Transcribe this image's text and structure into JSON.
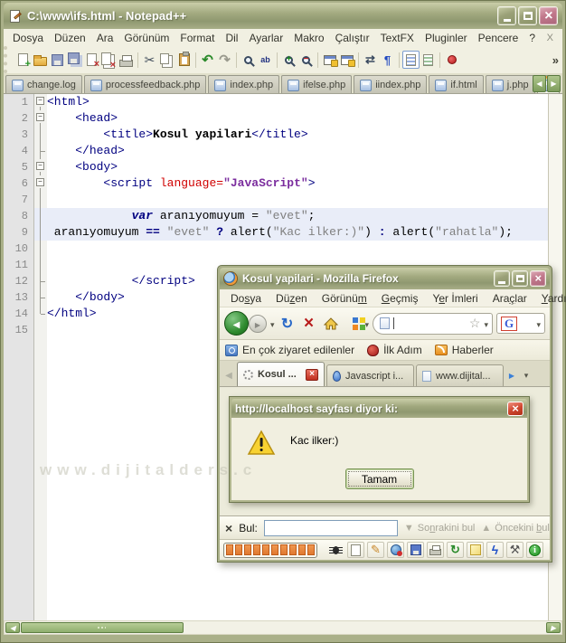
{
  "watermark": "www.dijitalders.c",
  "colors": {
    "titlebar_olive": "#9ba37a",
    "close_pink": "#c2798c",
    "chrome_bg": "#f1f0e2",
    "tab_active_orange": "#f0a13c",
    "selection_blue": "#e9edf8",
    "progress_orange": "#e07830"
  },
  "npp": {
    "title": "C:\\www\\ifs.html - Notepad++",
    "menu": [
      "Dosya",
      "Düzen",
      "Ara",
      "Görünüm",
      "Format",
      "Dil",
      "Ayarlar",
      "Makro",
      "Çalıştır",
      "TextFX",
      "Pluginler",
      "Pencere",
      "?"
    ],
    "menu_close": "X",
    "toolbar_overflow": "»",
    "toolbar": [
      {
        "name": "new"
      },
      {
        "name": "open"
      },
      {
        "name": "save"
      },
      {
        "name": "save-copy"
      },
      {
        "name": "close"
      },
      {
        "name": "close-all"
      },
      {
        "name": "print"
      },
      {
        "sep": true
      },
      {
        "name": "cut"
      },
      {
        "name": "copy"
      },
      {
        "name": "paste"
      },
      {
        "sep": true
      },
      {
        "name": "undo"
      },
      {
        "name": "redo"
      },
      {
        "sep": true
      },
      {
        "name": "find"
      },
      {
        "name": "find2"
      },
      {
        "sep": true
      },
      {
        "name": "zoom-in"
      },
      {
        "name": "zoom-out"
      },
      {
        "sep": true
      },
      {
        "name": "sync-v"
      },
      {
        "name": "sync-h"
      },
      {
        "sep": true
      },
      {
        "name": "wrap"
      },
      {
        "name": "symbols"
      },
      {
        "sep": true
      },
      {
        "name": "doc-map",
        "active": true
      },
      {
        "name": "func-list"
      },
      {
        "sep": true
      },
      {
        "name": "record"
      }
    ],
    "tabs": [
      {
        "label": "change.log"
      },
      {
        "label": "processfeedback.php"
      },
      {
        "label": "index.php"
      },
      {
        "label": "ifelse.php"
      },
      {
        "label": "iindex.php"
      },
      {
        "label": "if.html"
      },
      {
        "label": "j.php"
      },
      {
        "label": "",
        "active": true
      }
    ],
    "code_lines": [
      {
        "n": 1,
        "fold": "start",
        "segs": [
          [
            "tag",
            "<html>"
          ]
        ]
      },
      {
        "n": 2,
        "fold": "start",
        "segs": [
          [
            "pl",
            "    "
          ],
          [
            "tag",
            "<head>"
          ]
        ]
      },
      {
        "n": 3,
        "fold": "mid",
        "segs": [
          [
            "pl",
            "        "
          ],
          [
            "tag",
            "<title>"
          ],
          [
            "bold",
            "Kosul yapilari"
          ],
          [
            "tag",
            "</title>"
          ]
        ]
      },
      {
        "n": 4,
        "fold": "end",
        "segs": [
          [
            "pl",
            "    "
          ],
          [
            "tag",
            "</head>"
          ]
        ]
      },
      {
        "n": 5,
        "fold": "start",
        "segs": [
          [
            "pl",
            "    "
          ],
          [
            "tag",
            "<body>"
          ]
        ]
      },
      {
        "n": 6,
        "fold": "start",
        "segs": [
          [
            "pl",
            "        "
          ],
          [
            "tag",
            "<script "
          ],
          [
            "attr",
            "language="
          ],
          [
            "attrval",
            "\"JavaScript\""
          ],
          [
            "tag",
            ">"
          ]
        ]
      },
      {
        "n": 7,
        "fold": "mid",
        "segs": []
      },
      {
        "n": 8,
        "fold": "mid",
        "sel": true,
        "segs": [
          [
            "pl",
            "            "
          ],
          [
            "kw",
            "var"
          ],
          [
            "pl",
            " aranıyomuyum = "
          ],
          [
            "str",
            "\"evet\""
          ],
          [
            "pl",
            ";"
          ]
        ]
      },
      {
        "n": 9,
        "fold": "mid",
        "sel": true,
        "segs": [
          [
            "pl",
            " aranıyomuyum "
          ],
          [
            "op",
            "=="
          ],
          [
            "pl",
            " "
          ],
          [
            "str",
            "\"evet\""
          ],
          [
            "pl",
            " "
          ],
          [
            "op",
            "?"
          ],
          [
            "pl",
            " alert("
          ],
          [
            "str",
            "\"Kac ilker:)\""
          ],
          [
            "pl",
            ") "
          ],
          [
            "op",
            ":"
          ],
          [
            "pl",
            " alert("
          ],
          [
            "str",
            "\"rahatla\""
          ],
          [
            "pl",
            ");"
          ]
        ]
      },
      {
        "n": 10,
        "fold": "mid",
        "segs": []
      },
      {
        "n": 11,
        "fold": "mid",
        "segs": []
      },
      {
        "n": 12,
        "fold": "end",
        "segs": [
          [
            "pl",
            "            "
          ],
          [
            "tag",
            "</script>"
          ]
        ]
      },
      {
        "n": 13,
        "fold": "end",
        "segs": [
          [
            "pl",
            "    "
          ],
          [
            "tag",
            "</body>"
          ]
        ]
      },
      {
        "n": 14,
        "fold": "last",
        "segs": [
          [
            "tag",
            "</html>"
          ]
        ]
      },
      {
        "n": 15,
        "fold": "none",
        "segs": []
      }
    ]
  },
  "firefox": {
    "title": "Kosul yapilari - Mozilla Firefox",
    "menu": [
      {
        "label": "Dosya",
        "ul": 2
      },
      {
        "label": "Düzen",
        "ul": 2
      },
      {
        "label": "Görünüm",
        "ul": 6
      },
      {
        "label": "Geçmiş",
        "ul": 0
      },
      {
        "label": "Yer İmleri",
        "ul": 1
      },
      {
        "label": "Araçlar",
        "ul": 3
      },
      {
        "label": "Yardım",
        "ul": 0
      }
    ],
    "nav": {
      "urlbar_value": "",
      "search_engine": "G"
    },
    "bookmarks": [
      {
        "icon": "most",
        "label": "En çok ziyaret edilenler"
      },
      {
        "icon": "started",
        "label": "İlk Adım"
      },
      {
        "icon": "rss",
        "label": "Haberler"
      }
    ],
    "tabs": [
      {
        "icon": "spinner",
        "label": "Kosul ...",
        "active": true,
        "closable": true
      },
      {
        "icon": "js-doc",
        "label": "Javascript i..."
      },
      {
        "icon": "page",
        "label": "www.dijital..."
      }
    ],
    "findbar": {
      "label": "Bul:",
      "input_value": "",
      "next": {
        "label": "Sonrakini bul",
        "ul": 2
      },
      "prev": {
        "label": "Öncekini bul",
        "ul": 9
      }
    },
    "statusbar": {
      "progress_blocks": 10,
      "icons": [
        "bug",
        "page",
        "pencil",
        "globe",
        "save",
        "print",
        "reload",
        "note",
        "lightning",
        "tools",
        "info"
      ]
    }
  },
  "dialog": {
    "title": "http://localhost sayfası diyor ki:",
    "message": "Kac ilker:)",
    "ok_label": "Tamam"
  }
}
